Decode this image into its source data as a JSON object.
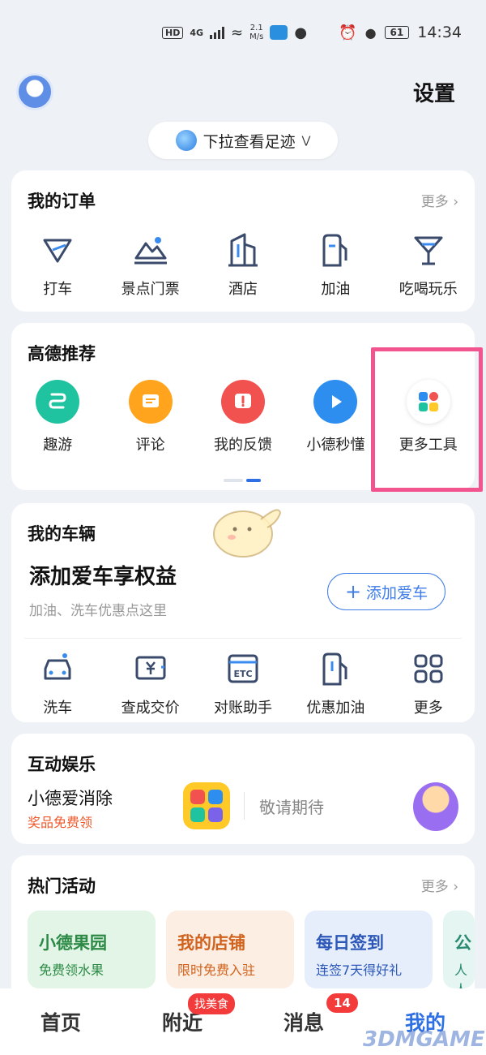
{
  "status_bar": {
    "hd": "HD",
    "net": "4G",
    "speed_top": "2.1",
    "speed_bottom": "M/s",
    "battery": "61",
    "time": "14:34"
  },
  "header": {
    "settings_label": "设置"
  },
  "footprint": {
    "label": "下拉查看足迹"
  },
  "orders": {
    "title": "我的订单",
    "more": "更多",
    "items": [
      {
        "label": "打车",
        "icon": "taxi-icon"
      },
      {
        "label": "景点门票",
        "icon": "scenic-icon"
      },
      {
        "label": "酒店",
        "icon": "hotel-icon"
      },
      {
        "label": "加油",
        "icon": "fuel-icon"
      },
      {
        "label": "吃喝玩乐",
        "icon": "cocktail-icon"
      }
    ]
  },
  "recommend": {
    "title": "高德推荐",
    "items": [
      {
        "label": "趣游",
        "icon": "route-icon",
        "color": "#20c3a0"
      },
      {
        "label": "评论",
        "icon": "comment-icon",
        "color": "#ffa41c"
      },
      {
        "label": "我的反馈",
        "icon": "feedback-icon",
        "color": "#f2524f"
      },
      {
        "label": "小德秒懂",
        "icon": "play-icon",
        "color": "#2e8ef0"
      },
      {
        "label": "更多工具",
        "icon": "grid-apps-icon",
        "color": "#ffffff"
      }
    ]
  },
  "vehicle": {
    "title": "我的车辆",
    "headline": "添加爱车享权益",
    "subline": "加油、洗车优惠点这里",
    "add_button": "添加爱车",
    "items": [
      {
        "label": "洗车",
        "icon": "car-wash-icon"
      },
      {
        "label": "查成交价",
        "icon": "price-icon"
      },
      {
        "label": "对账助手",
        "icon": "etc-icon"
      },
      {
        "label": "优惠加油",
        "icon": "fuel-discount-icon"
      },
      {
        "label": "更多",
        "icon": "more-grid-icon"
      }
    ]
  },
  "entertainment": {
    "title": "互动娱乐",
    "game_name": "小德爱消除",
    "game_sub": "奖品免费领",
    "coming": "敬请期待"
  },
  "activities": {
    "title": "热门活动",
    "more": "更多",
    "cards": [
      {
        "title": "小德果园",
        "sub": "免费领水果",
        "bg": "#e3f5e6",
        "color": "#2c8a46"
      },
      {
        "title": "我的店铺",
        "sub": "限时免费入驻",
        "bg": "#fdeee3",
        "color": "#d0621d"
      },
      {
        "title": "每日签到",
        "sub": "连签7天得好礼",
        "bg": "#e6eefc",
        "color": "#2b57b8"
      },
      {
        "title": "公",
        "sub": "人人",
        "bg": "#e5f5f1",
        "color": "#2a8a72"
      }
    ]
  },
  "tabbar": {
    "tabs": [
      "首页",
      "附近",
      "消息",
      "我的"
    ],
    "badge_food": "找美食",
    "badge_count": "14"
  },
  "watermark": "3DMGAME"
}
